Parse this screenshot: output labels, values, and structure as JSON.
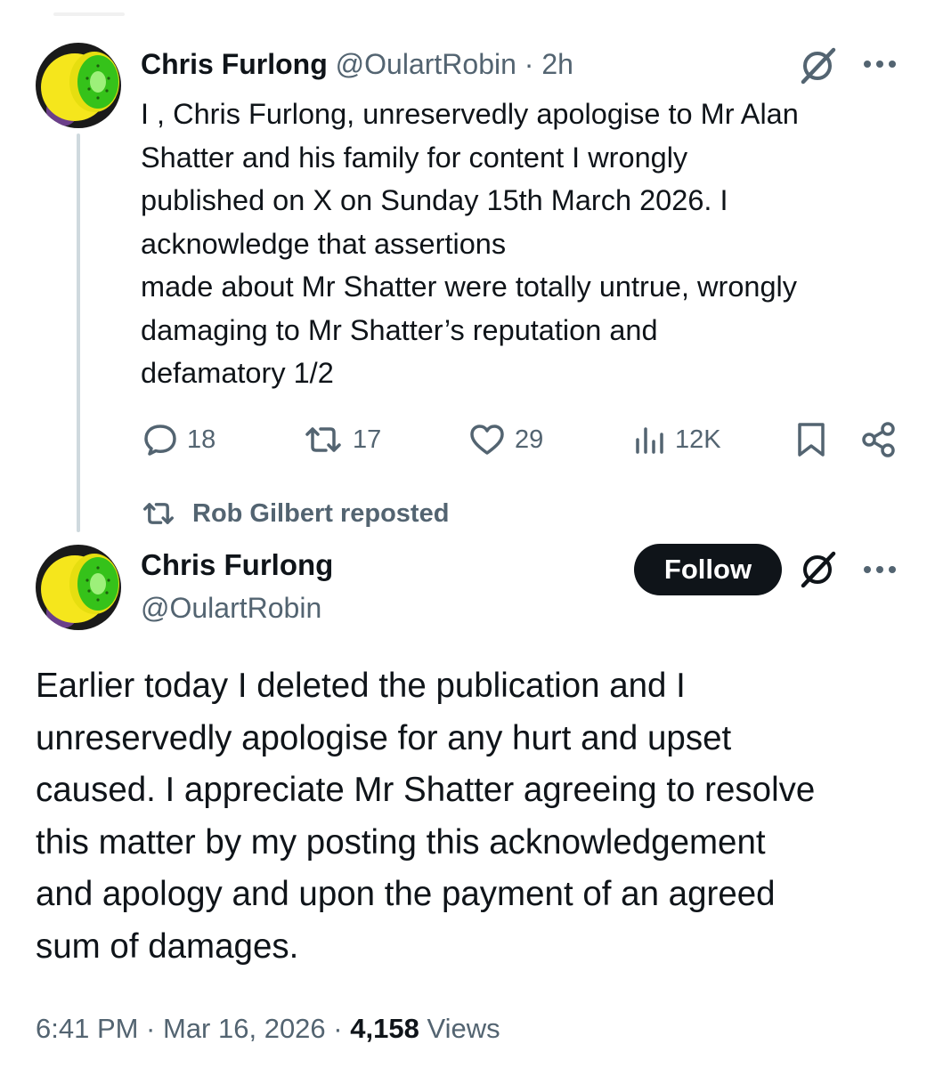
{
  "tweet1": {
    "author_name": "Chris Furlong",
    "handle": "@OulartRobin",
    "separator": "·",
    "time": "2h",
    "body_lines": [
      "I , Chris Furlong, unreservedly apologise to Mr Alan",
      "Shatter and his family  for content I wrongly",
      "published on X on  Sunday 15th March 2026. I",
      "acknowledge that assertions",
      "made about Mr Shatter were  totally untrue, wrongly",
      "damaging to Mr Shatter’s  reputation and",
      "defamatory 1/2"
    ],
    "actions": {
      "replies": "18",
      "reposts": "17",
      "likes": "29",
      "views": "12K"
    }
  },
  "repost_context": "Rob Gilbert reposted",
  "tweet2": {
    "author_name": "Chris Furlong",
    "handle": "@OulartRobin",
    "follow_label": "Follow",
    "body_lines": [
      "Earlier today I deleted the publication and I",
      "unreservedly apologise for any hurt and upset",
      "caused. I appreciate Mr Shatter agreeing to resolve",
      "this matter by my posting this acknowledgement",
      "and apology and upon the payment of an agreed",
      "sum of damages."
    ],
    "timestamp": "6:41 PM · Mar 16, 2026",
    "meta_separator": "·",
    "views_count": "4,158",
    "views_label": "Views"
  },
  "icons": {
    "grok": "grok-icon",
    "more": "more-icon",
    "reply": "reply-icon",
    "repost": "repost-icon",
    "like": "heart-icon",
    "views": "analytics-icon",
    "bookmark": "bookmark-icon",
    "share": "share-icon"
  },
  "colors": {
    "text": "#0f1419",
    "muted": "#536471",
    "thread_line": "#cfd9de",
    "follow_bg": "#0f1419",
    "avatar_yellow": "#f5e61c",
    "avatar_green": "#35c21a"
  }
}
